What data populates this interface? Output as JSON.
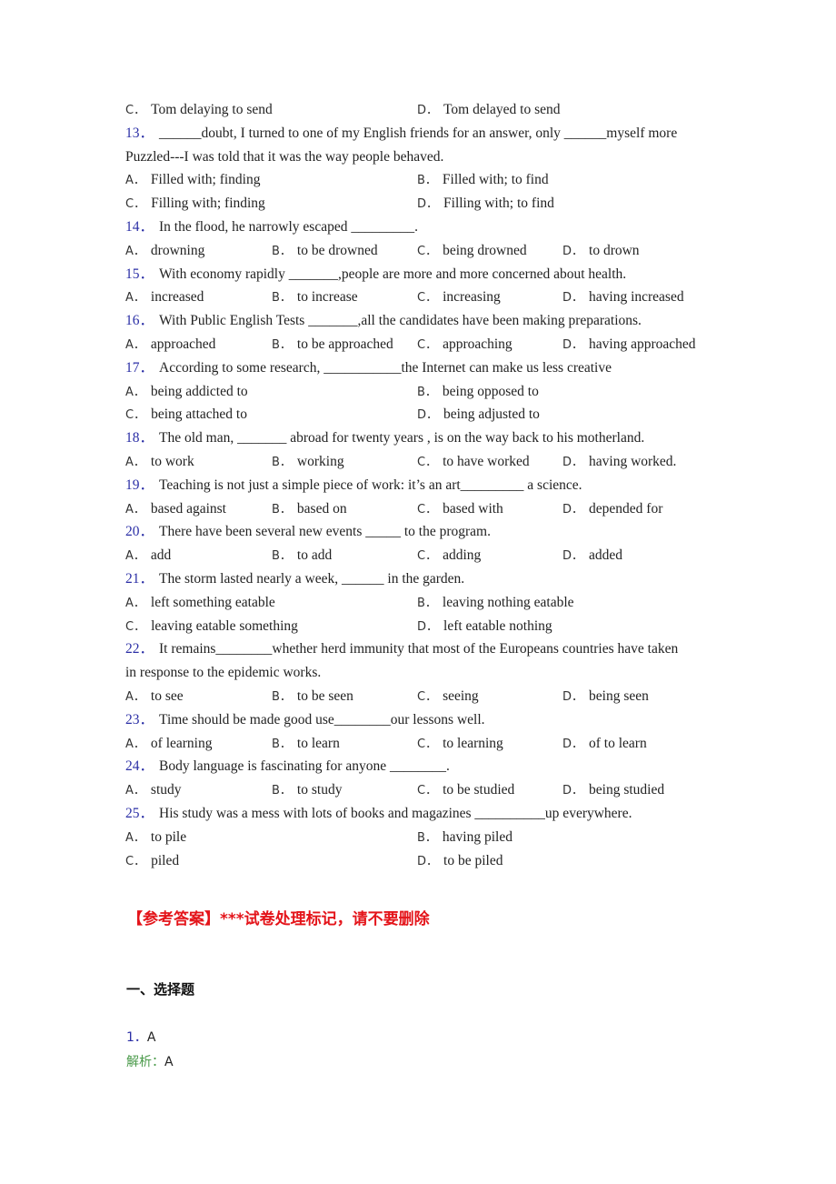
{
  "q12_tail": {
    "options": [
      {
        "letter": "C．",
        "text": "Tom delaying to send"
      },
      {
        "letter": "D．",
        "text": "Tom delayed to send"
      }
    ]
  },
  "questions": [
    {
      "num": "13．",
      "lines": [
        "______doubt, I turned to one of my English friends for an answer, only ______myself more",
        "Puzzled---I was told that it was the way people behaved."
      ],
      "options": [
        {
          "letter": "A．",
          "text": "Filled with; finding"
        },
        {
          "letter": "B．",
          "text": "Filled with; to find"
        },
        {
          "letter": "C．",
          "text": "Filling with; finding"
        },
        {
          "letter": "D．",
          "text": "Filling with; to find"
        }
      ]
    },
    {
      "num": "14．",
      "lines": [
        "In the flood, he narrowly escaped _________."
      ],
      "options": [
        {
          "letter": "A．",
          "text": "drowning"
        },
        {
          "letter": "B．",
          "text": "to be drowned"
        },
        {
          "letter": "C．",
          "text": "being drowned"
        },
        {
          "letter": "D．",
          "text": "to drown"
        }
      ]
    },
    {
      "num": "15．",
      "lines": [
        "With economy rapidly _______,people are more and more concerned about health."
      ],
      "options": [
        {
          "letter": "A．",
          "text": "increased"
        },
        {
          "letter": "B．",
          "text": "to increase"
        },
        {
          "letter": "C．",
          "text": "increasing"
        },
        {
          "letter": "D．",
          "text": "having increased"
        }
      ]
    },
    {
      "num": "16．",
      "lines": [
        "With Public English Tests _______,all the candidates have been making preparations."
      ],
      "options": [
        {
          "letter": "A．",
          "text": "approached"
        },
        {
          "letter": "B．",
          "text": "to be approached"
        },
        {
          "letter": "C．",
          "text": "approaching"
        },
        {
          "letter": "D．",
          "text": "having approached"
        }
      ]
    },
    {
      "num": "17．",
      "lines": [
        "According to some research, ___________the Internet can make us less creative"
      ],
      "options": [
        {
          "letter": "A．",
          "text": "being addicted to"
        },
        {
          "letter": "B．",
          "text": "being opposed to"
        },
        {
          "letter": "C．",
          "text": "being attached to"
        },
        {
          "letter": "D．",
          "text": "being adjusted to"
        }
      ]
    },
    {
      "num": "18．",
      "lines": [
        "The old man, _______ abroad for twenty years , is on the way back to his motherland."
      ],
      "options": [
        {
          "letter": "A．",
          "text": "to work"
        },
        {
          "letter": "B．",
          "text": "working"
        },
        {
          "letter": "C．",
          "text": "to have worked"
        },
        {
          "letter": "D．",
          "text": "having worked."
        }
      ]
    },
    {
      "num": "19．",
      "lines": [
        "Teaching is not just a simple piece of work: it’s an art_________ a science."
      ],
      "options": [
        {
          "letter": "A．",
          "text": "based against"
        },
        {
          "letter": "B．",
          "text": "based on"
        },
        {
          "letter": "C．",
          "text": "based with"
        },
        {
          "letter": "D．",
          "text": "depended for"
        }
      ]
    },
    {
      "num": "20．",
      "lines": [
        "There have been several new events _____ to the program."
      ],
      "options": [
        {
          "letter": "A．",
          "text": "add"
        },
        {
          "letter": "B．",
          "text": "to add"
        },
        {
          "letter": "C．",
          "text": "adding"
        },
        {
          "letter": "D．",
          "text": "added"
        }
      ]
    },
    {
      "num": "21．",
      "lines": [
        "The storm lasted nearly a week, ______ in the garden."
      ],
      "options": [
        {
          "letter": "A．",
          "text": "left something eatable"
        },
        {
          "letter": "B．",
          "text": "leaving nothing eatable"
        },
        {
          "letter": "C．",
          "text": "leaving eatable something"
        },
        {
          "letter": "D．",
          "text": "left eatable nothing"
        }
      ]
    },
    {
      "num": "22．",
      "lines": [
        "It remains________whether herd immunity that most of the Europeans countries have taken",
        "in response to the epidemic works."
      ],
      "options": [
        {
          "letter": "A．",
          "text": "to see"
        },
        {
          "letter": "B．",
          "text": "to be seen"
        },
        {
          "letter": "C．",
          "text": "seeing"
        },
        {
          "letter": "D．",
          "text": "being seen"
        }
      ]
    },
    {
      "num": "23．",
      "lines": [
        "Time should be made good use________our lessons well."
      ],
      "options": [
        {
          "letter": "A．",
          "text": "of learning"
        },
        {
          "letter": "B．",
          "text": "to learn"
        },
        {
          "letter": "C．",
          "text": "to learning"
        },
        {
          "letter": "D．",
          "text": "of to learn"
        }
      ]
    },
    {
      "num": "24．",
      "lines": [
        "Body language is fascinating for anyone ________."
      ],
      "options": [
        {
          "letter": "A．",
          "text": "study"
        },
        {
          "letter": "B．",
          "text": "to study"
        },
        {
          "letter": "C．",
          "text": "to be studied"
        },
        {
          "letter": "D．",
          "text": "being studied"
        }
      ]
    },
    {
      "num": "25．",
      "lines": [
        "His study was a mess with lots of books and magazines __________up everywhere."
      ],
      "options": [
        {
          "letter": "A．",
          "text": "to pile"
        },
        {
          "letter": "B．",
          "text": "having piled"
        },
        {
          "letter": "C．",
          "text": "piled"
        },
        {
          "letter": "D．",
          "text": "to be piled"
        }
      ]
    }
  ],
  "answer_section": {
    "title": "【参考答案】***试卷处理标记，请不要删除",
    "section_heading": "一、选择题",
    "first_answer": {
      "num": "1．",
      "value": "A"
    },
    "analysis_label": "解析：",
    "analysis_value": "A"
  },
  "colors": {
    "question_number": "#2b2fa6",
    "answer_title": "#e4141a",
    "analysis_label": "#4a9a4a"
  }
}
